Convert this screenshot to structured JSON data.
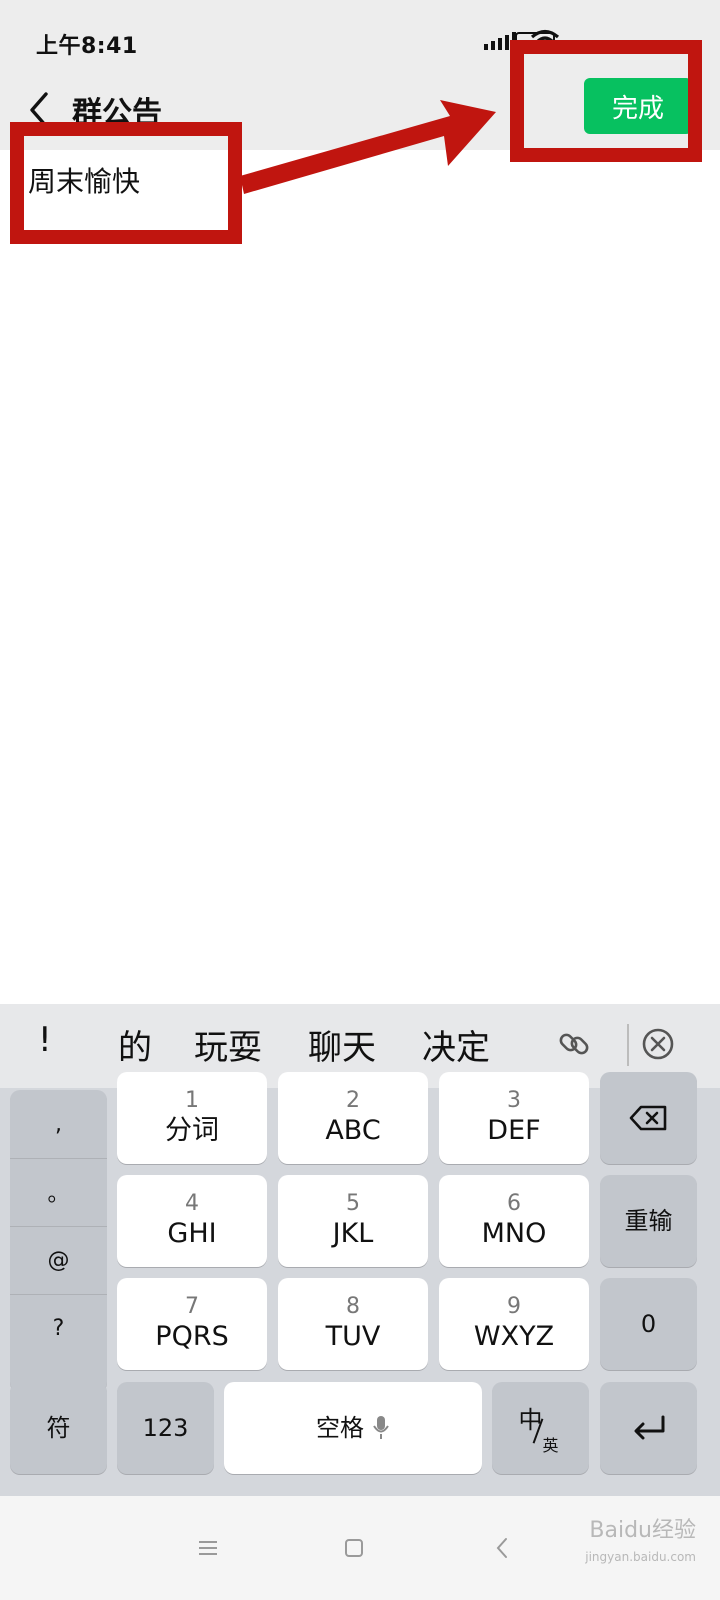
{
  "status_bar": {
    "time": "上午8:41"
  },
  "header": {
    "title": "群公告",
    "done_label": "完成"
  },
  "content": {
    "notice_text": "周末愉快"
  },
  "keyboard": {
    "candidates": [
      "!",
      "的",
      "玩耍",
      "聊天",
      "决定"
    ],
    "punctuation": [
      ",",
      "。",
      "@",
      "?"
    ],
    "keys": {
      "k1": {
        "num": "1",
        "label": "分词"
      },
      "k2": {
        "num": "2",
        "label": "ABC"
      },
      "k3": {
        "num": "3",
        "label": "DEF"
      },
      "k4": {
        "num": "4",
        "label": "GHI"
      },
      "k5": {
        "num": "5",
        "label": "JKL"
      },
      "k6": {
        "num": "6",
        "label": "MNO"
      },
      "k7": {
        "num": "7",
        "label": "PQRS"
      },
      "k8": {
        "num": "8",
        "label": "TUV"
      },
      "k9": {
        "num": "9",
        "label": "WXYZ"
      }
    },
    "reinput_label": "重输",
    "zero_label": "0",
    "symbol_label": "符",
    "num_label": "123",
    "space_label": "空格",
    "lang_main": "中",
    "lang_sub": "英"
  },
  "watermark": {
    "text": "Baidu经验",
    "sub": "jingyan.baidu.com"
  },
  "colors": {
    "accent": "#07c160",
    "annotation": "#c0150f"
  }
}
